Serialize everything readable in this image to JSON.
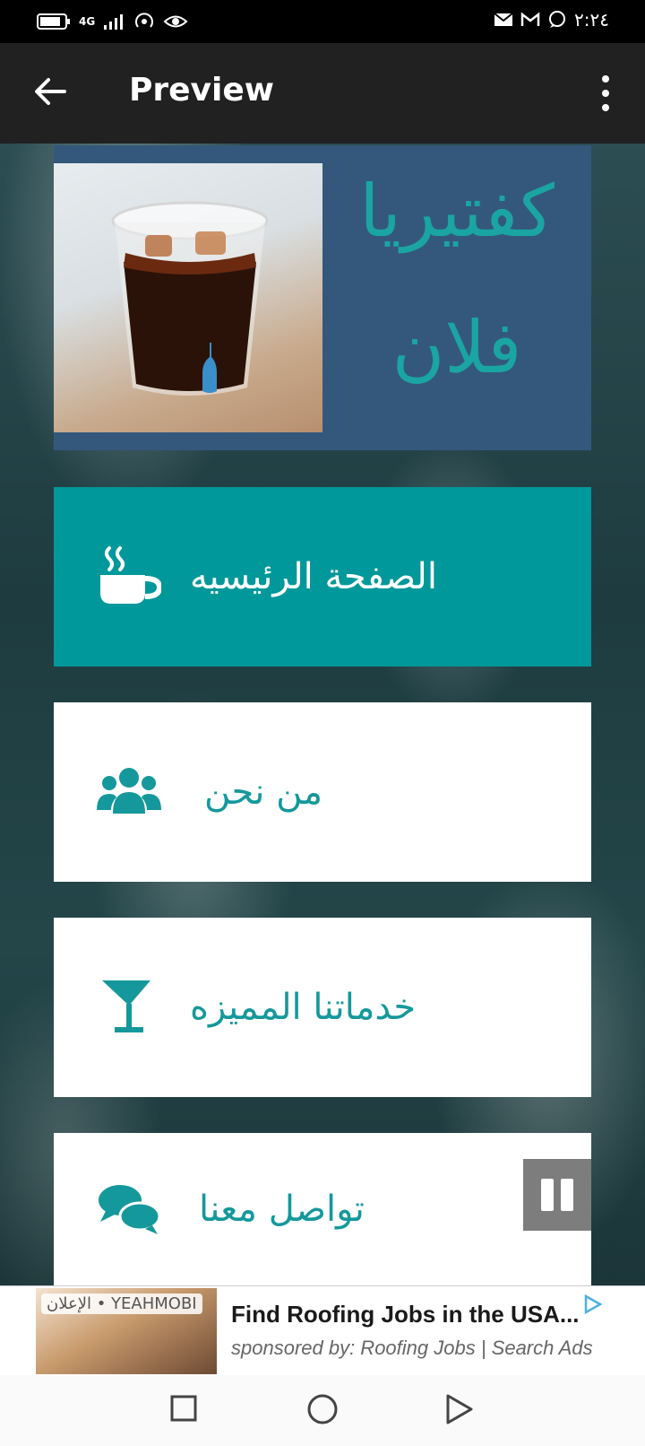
{
  "status_bar": {
    "network": "4G",
    "time": "٢:٢٤"
  },
  "app_bar": {
    "title": "Preview",
    "back_icon": "arrow-left-icon",
    "menu_icon": "more-vert-icon"
  },
  "header": {
    "brand_line_1": "كفتيريا",
    "brand_line_2": "فلان",
    "brand_color": "#1aa5a3",
    "panel_color": "#34587c"
  },
  "menu": {
    "items": [
      {
        "label": "الصفحة الرئيسيه",
        "icon": "coffee-cup-icon",
        "style": "primary"
      },
      {
        "label": "من نحن",
        "icon": "users-group-icon",
        "style": "white"
      },
      {
        "label": "خدماتنا المميزه",
        "icon": "cocktail-glass-icon",
        "style": "white"
      },
      {
        "label": "تواصل معنا",
        "icon": "chat-bubbles-icon",
        "style": "white"
      }
    ],
    "accent": "#00989a"
  },
  "ad": {
    "tag": "الإعلان • YEAHMOBI",
    "headline": "Find Roofing Jobs in the USA...",
    "sponsored": "sponsored by: Roofing Jobs | Search Ads"
  },
  "nav_bar": {
    "icons": [
      "square-recents-icon",
      "circle-home-icon",
      "triangle-back-icon"
    ]
  }
}
